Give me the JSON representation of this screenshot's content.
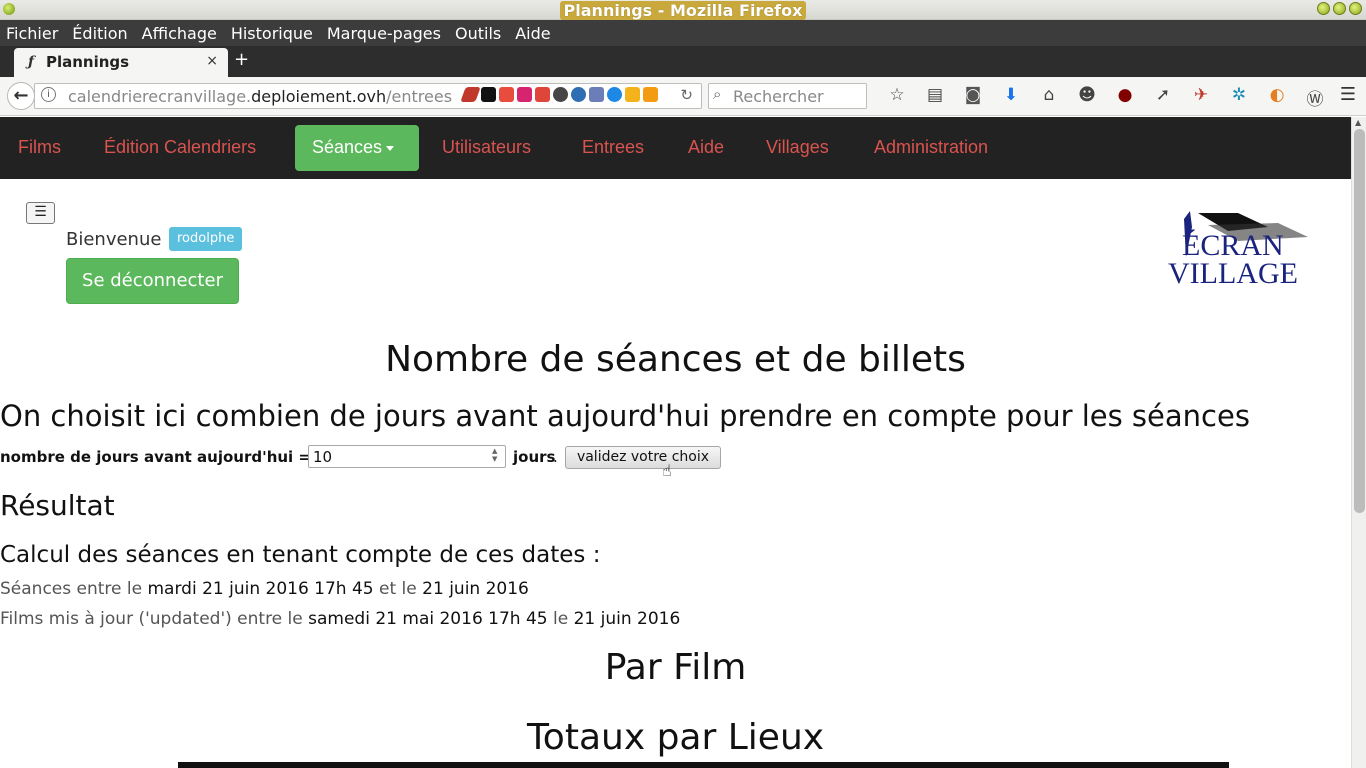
{
  "window": {
    "title": "Plannings - Mozilla Firefox"
  },
  "menubar": {
    "items": [
      "Fichier",
      "Édition",
      "Affichage",
      "Historique",
      "Marque-pages",
      "Outils",
      "Aide"
    ]
  },
  "tab": {
    "title": "Plannings",
    "close": "×",
    "new_tab": "+"
  },
  "url": {
    "prefix": "calendrierecranvillage.",
    "domain": "deploiement.ovh",
    "path": "/entrees"
  },
  "search": {
    "placeholder": "Rechercher"
  },
  "sitenav": {
    "items": [
      "Films",
      "Édition Calendriers",
      "Utilisateurs",
      "Entrees",
      "Aide",
      "Villages",
      "Administration"
    ],
    "active": "Séances"
  },
  "user": {
    "welcome": "Bienvenue !",
    "username": "rodolphe",
    "logout": "Se déconnecter"
  },
  "logo": {
    "line1": "ÉCRAN",
    "line2": "VILLAGE"
  },
  "content": {
    "title": "Nombre de séances et de billets",
    "subtitle": "On choisit ici combien de jours avant aujourd'hui prendre en compte pour les séances",
    "form": {
      "label": "nombre de jours avant aujourd'hui =",
      "value": "10",
      "unit": "jours",
      "submit": "validez votre choix"
    },
    "result_heading": "Résultat",
    "calc_heading": "Calcul des séances en tenant compte de ces dates :",
    "line1": {
      "a": "Séances entre le",
      "b": "mardi 21 juin 2016 17h 45",
      "c": "et le",
      "d": "21 juin 2016"
    },
    "line2": {
      "a": "Films mis à jour ('updated') entre le",
      "b": "samedi 21 mai 2016 17h 45",
      "c": "le",
      "d": "21 juin 2016"
    },
    "par_film": "Par Film",
    "totaux": "Totaux par Lieux"
  },
  "colors": {
    "nav_bg": "#222222",
    "nav_link": "#d9534f",
    "success": "#5cb85c",
    "info_badge": "#5bc0de"
  }
}
